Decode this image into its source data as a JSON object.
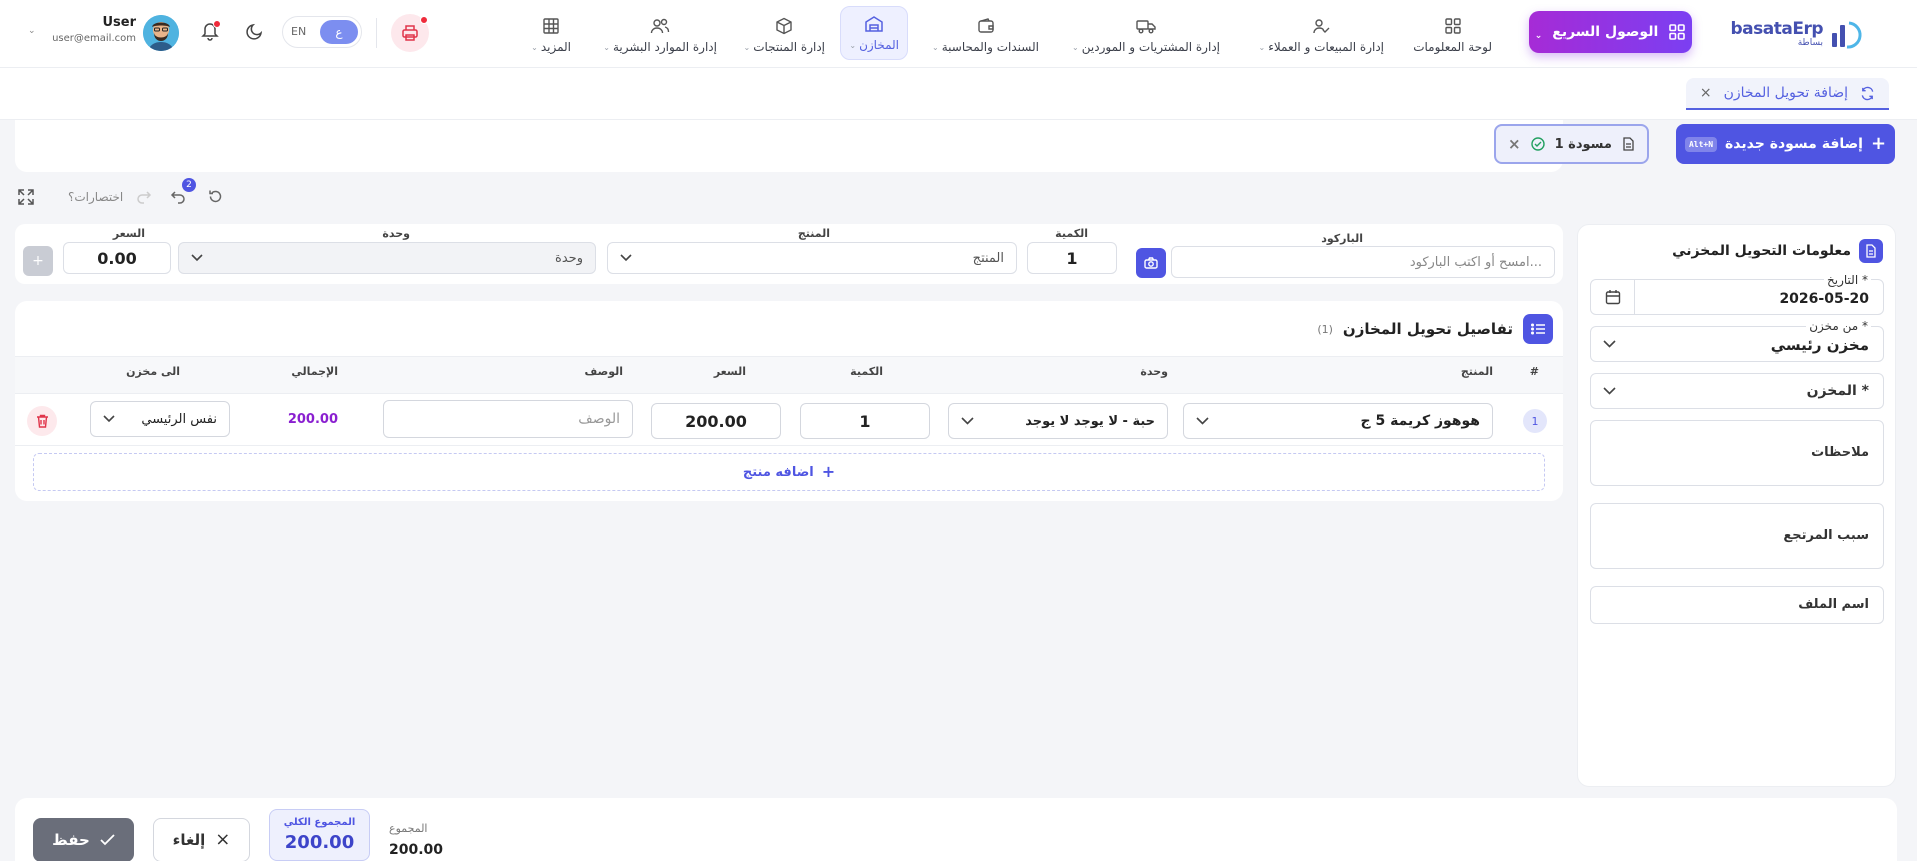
{
  "header": {
    "logo_text": "basataErp",
    "logo_sub": "بساطة",
    "quick_access": "الوصول السريع",
    "nav": [
      {
        "label": "لوحة المعلومات",
        "icon": "grid-icon"
      },
      {
        "label": "إدارة المبيعات و العملاء",
        "icon": "user-check-icon"
      },
      {
        "label": "إدارة المشتريات و الموردين",
        "icon": "truck-icon"
      },
      {
        "label": "السندات والمحاسبة",
        "icon": "wallet-icon"
      },
      {
        "label": "المخازن",
        "icon": "warehouse-icon"
      },
      {
        "label": "إدارة المنتجات",
        "icon": "box-icon"
      },
      {
        "label": "إدارة الموارد البشرية",
        "icon": "users-icon"
      },
      {
        "label": "المزيد",
        "icon": "table-icon"
      }
    ],
    "lang_en": "EN",
    "lang_ar": "ع",
    "user_name": "User",
    "user_email": "user@email.com"
  },
  "tabs": {
    "current": "إضافة تحويل المخازن"
  },
  "drafts": {
    "add_label": "إضافة مسودة جديدة",
    "shortcut": "Alt+N",
    "chip_label": "مسودة 1"
  },
  "tools": {
    "shortcuts": "اختصارات",
    "undo_count": "2"
  },
  "entry": {
    "barcode_label": "الباركود",
    "barcode_placeholder": "امسح أو اكتب الباركود...",
    "qty_label": "الكمية",
    "qty_value": "1",
    "product_label": "المنتج",
    "product_placeholder": "المنتج",
    "unit_label": "وحدة",
    "unit_placeholder": "وحدة",
    "price_label": "السعر",
    "price_value": "0.00"
  },
  "side": {
    "title": "معلومات التحويل المخزني",
    "date_label": "التاريخ *",
    "date_value": "2026-05-20",
    "from_label": "من مخزن *",
    "from_value": "مخزن رئيسي",
    "to_label": "المخزن *",
    "notes": "ملاحظات",
    "return_reason": "سبب المرتجع",
    "file_name": "اسم الملف"
  },
  "details": {
    "title": "تفاصيل تحويل المخازن",
    "count": "(1)",
    "columns": [
      "#",
      "المنتج",
      "وحدة",
      "الكمية",
      "السعر",
      "الوصف",
      "الإجمالي",
      "الى مخزن"
    ],
    "row": {
      "index": "1",
      "product": "هوهوز كريمة 5 ج",
      "unit": "حبة - لا يوجد لا يوجد",
      "qty": "1",
      "price": "200.00",
      "description_placeholder": "الوصف",
      "total": "200.00",
      "to_store": "نفس الرئيسي"
    },
    "add_product": "اضافه منتج"
  },
  "footer": {
    "save": "حفظ",
    "cancel": "إلغاء",
    "grand_total_label": "المجموع الكلي",
    "grand_total_value": "200.00",
    "subtotal_label": "المجموع",
    "subtotal_value": "200.00"
  },
  "colors": {
    "primary": "#4f55e2",
    "accent_purple": "#9a2fd8",
    "total_purple": "#8a1fd0",
    "danger": "#ef2b3b"
  }
}
